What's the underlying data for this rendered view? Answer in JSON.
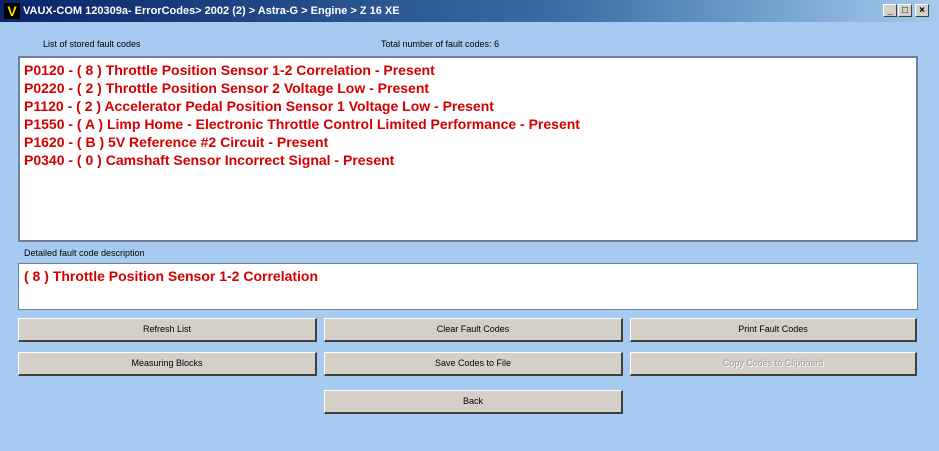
{
  "window": {
    "icon_letter": "V",
    "title": "VAUX-COM 120309a- ErrorCodes> 2002 (2) > Astra-G > Engine > Z 16 XE",
    "min_glyph": "_",
    "max_glyph": "□",
    "close_glyph": "×"
  },
  "list": {
    "header": "List of stored fault codes",
    "total_label": "Total number of fault codes:  6",
    "items": [
      "P0120 - ( 8 )  Throttle Position Sensor 1-2 Correlation - Present",
      "P0220 - ( 2 )  Throttle Position Sensor 2 Voltage Low - Present",
      "P1120 - ( 2 )  Accelerator Pedal Position Sensor 1 Voltage Low - Present",
      "P1550 - ( A )  Limp Home - Electronic Throttle Control Limited Performance - Present",
      "P1620 - ( B )  5V Reference #2 Circuit - Present",
      "P0340 - ( 0 )  Camshaft Sensor Incorrect Signal - Present"
    ]
  },
  "detail": {
    "header": "Detailed fault code description",
    "text": "( 8 )  Throttle Position Sensor 1-2 Correlation"
  },
  "buttons": {
    "refresh": "Refresh List",
    "clear": "Clear Fault Codes",
    "print": "Print Fault Codes",
    "measuring": "Measuring Blocks",
    "save": "Save Codes to File",
    "copy": "Copy Codes to Clipboard",
    "back": "Back"
  },
  "colors": {
    "background": "#a6caf0",
    "fault_text": "#d40000",
    "button_face": "#d4d0c8"
  }
}
